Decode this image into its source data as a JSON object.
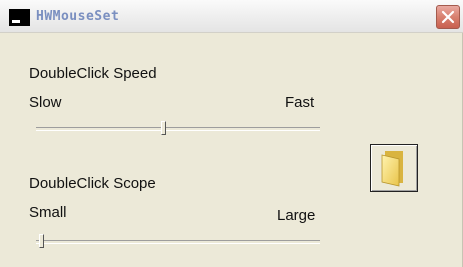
{
  "window": {
    "title": "HWMouseSet",
    "icons": {
      "app": "app-window-icon",
      "close": "close-icon",
      "folder": "folder-icon"
    }
  },
  "double_click_speed": {
    "label": "DoubleClick Speed",
    "min_label": "Slow",
    "max_label": "Fast",
    "value_fraction": 0.45
  },
  "double_click_scope": {
    "label": "DoubleClick Scope",
    "min_label": "Small",
    "max_label": "Large",
    "value_fraction": 0.02
  },
  "colors": {
    "close_button": "#d8806f",
    "title_text": "#7a8fc0",
    "window_bg": "#ece9d8"
  }
}
